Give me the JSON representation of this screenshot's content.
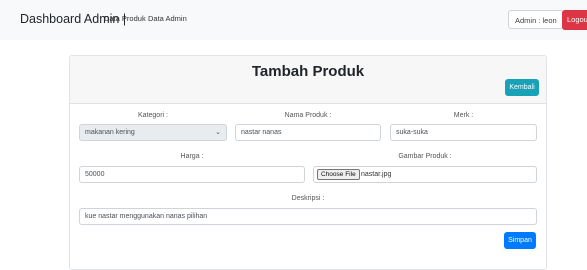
{
  "navbar": {
    "brand": "Dashboard Admin |",
    "links": [
      "Data Produk",
      "Data Admin"
    ],
    "admin_label": "Admin : leon",
    "logout_label": "Logout"
  },
  "card": {
    "title": "Tambah Produk",
    "back_label": "Kembali",
    "submit_label": "Simpan"
  },
  "form": {
    "kategori": {
      "label": "Kategori :",
      "value": "makanan kering"
    },
    "nama_produk": {
      "label": "Nama Produk :",
      "value": "nastar nanas"
    },
    "merk": {
      "label": "Merk :",
      "value": "suka-suka"
    },
    "harga": {
      "label": "Harga :",
      "value": "50000"
    },
    "gambar": {
      "label": "Gambar Produk :",
      "button_label": "Choose File",
      "file_name": "nastar.jpg"
    },
    "deskripsi": {
      "label": "Deskripsi :",
      "value": "kue nastar menggunakan nanas pilihan"
    }
  },
  "colors": {
    "navbar_bg": "#f8f9fa",
    "logout": "#dc3545",
    "back": "#17a2b8",
    "submit": "#007bff"
  }
}
